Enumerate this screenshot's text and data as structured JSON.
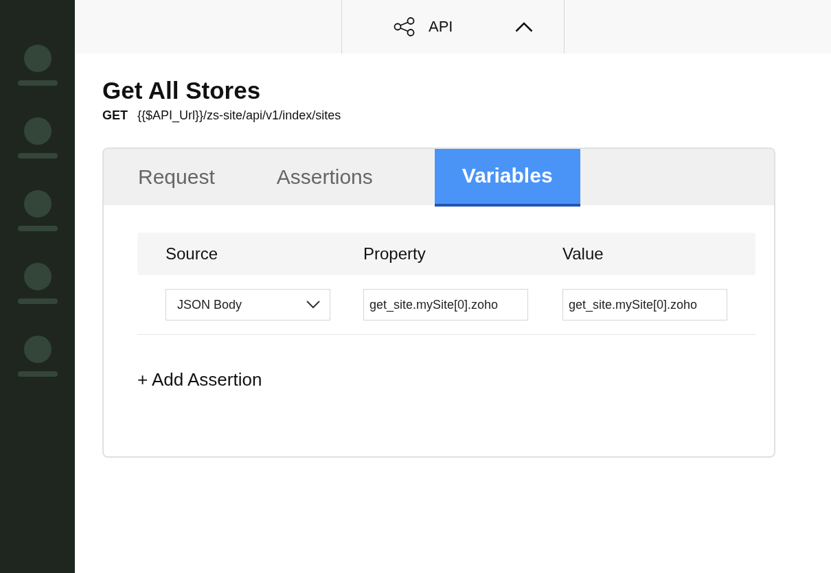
{
  "sidebar": {
    "items": [
      {
        "kind": "placeholder"
      },
      {
        "kind": "placeholder"
      },
      {
        "kind": "placeholder"
      },
      {
        "kind": "placeholder"
      },
      {
        "kind": "placeholder"
      }
    ]
  },
  "top_bar": {
    "section": {
      "label": "API",
      "expanded": true
    }
  },
  "header": {
    "title": "Get All Stores",
    "method": "GET",
    "url": "{{$API_Url}}/zs-site/api/v1/index/sites"
  },
  "tabs": [
    {
      "label": "Request",
      "selected": false
    },
    {
      "label": "Assertions",
      "selected": false
    },
    {
      "label": "Variables",
      "selected": true
    }
  ],
  "table": {
    "columns": [
      "Source",
      "Property",
      "Value"
    ],
    "rows": [
      {
        "cells": [
          {
            "kind": "dropdown",
            "value": "JSON Body"
          },
          {
            "kind": "input",
            "value": "get_site.mySite[0].zoho"
          },
          {
            "kind": "input",
            "value": "get_site.mySite[0].zoho"
          }
        ]
      }
    ]
  },
  "add_button": {
    "label": "+ Add Assertion"
  }
}
